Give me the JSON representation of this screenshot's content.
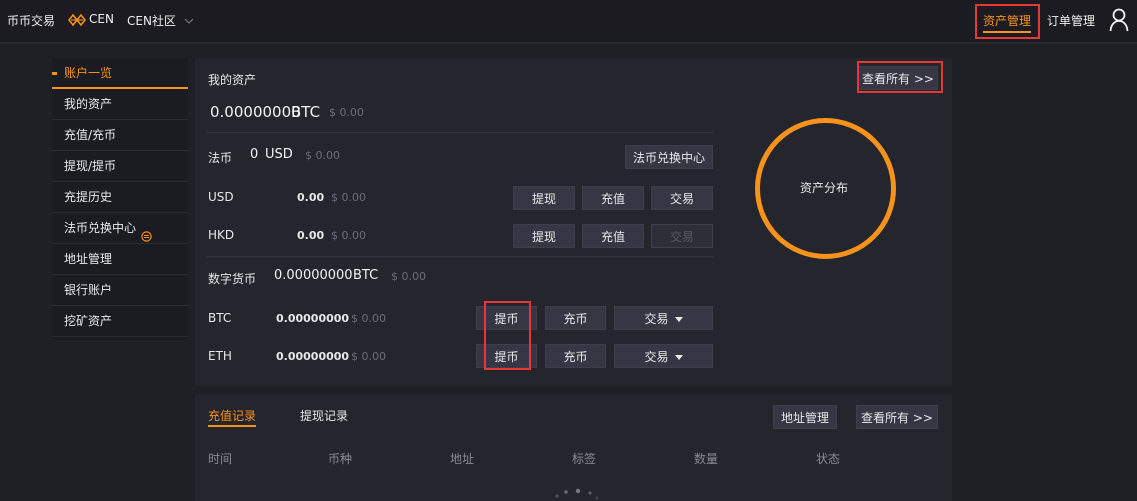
{
  "nav": {
    "coin_trade": "币币交易",
    "cen": "CEN",
    "cen_community": "CEN社区",
    "asset_mgmt": "资产管理",
    "order_mgmt": "订单管理",
    "accent": "#f7931a"
  },
  "sidebar": {
    "items": [
      {
        "label": "账户一览"
      },
      {
        "label": "我的资产"
      },
      {
        "label": "充值/充币"
      },
      {
        "label": "提现/提币"
      },
      {
        "label": "充提历史"
      },
      {
        "label": "法币兑换中心"
      },
      {
        "label": "地址管理"
      },
      {
        "label": "银行账户"
      },
      {
        "label": "挖矿资产"
      }
    ]
  },
  "assets": {
    "title": "我的资产",
    "view_all": "查看所有 >>",
    "total_btc": "0.00000000",
    "total_unit": "BTC",
    "total_usd": "$ 0.00",
    "fiat_label": "法币",
    "fiat_amount": "0",
    "fiat_unit": "USD",
    "fiat_usd": "$ 0.00",
    "fiat_exchange": "法币兑换中心",
    "fiat_rows": [
      {
        "name": "USD",
        "amount": "0.00",
        "usd": "$ 0.00",
        "withdraw": "提现",
        "deposit": "充值",
        "trade": "交易"
      },
      {
        "name": "HKD",
        "amount": "0.00",
        "usd": "$ 0.00",
        "withdraw": "提现",
        "deposit": "充值",
        "trade": "交易"
      }
    ],
    "crypto_label": "数字货币",
    "crypto_amount": "0.00000000",
    "crypto_unit": "BTC",
    "crypto_usd": "$ 0.00",
    "crypto_rows": [
      {
        "name": "BTC",
        "amount": "0.00000000",
        "usd": "$ 0.00",
        "withdraw": "提币",
        "deposit": "充币",
        "trade": "交易"
      },
      {
        "name": "ETH",
        "amount": "0.00000000",
        "usd": "$ 0.00",
        "withdraw": "提币",
        "deposit": "充币",
        "trade": "交易"
      }
    ],
    "distribution": "资产分布"
  },
  "records": {
    "tab_deposit": "充值记录",
    "tab_withdraw": "提现记录",
    "address_mgmt": "地址管理",
    "view_all": "查看所有 >>",
    "columns": [
      "时间",
      "币种",
      "地址",
      "标签",
      "数量",
      "状态"
    ]
  }
}
